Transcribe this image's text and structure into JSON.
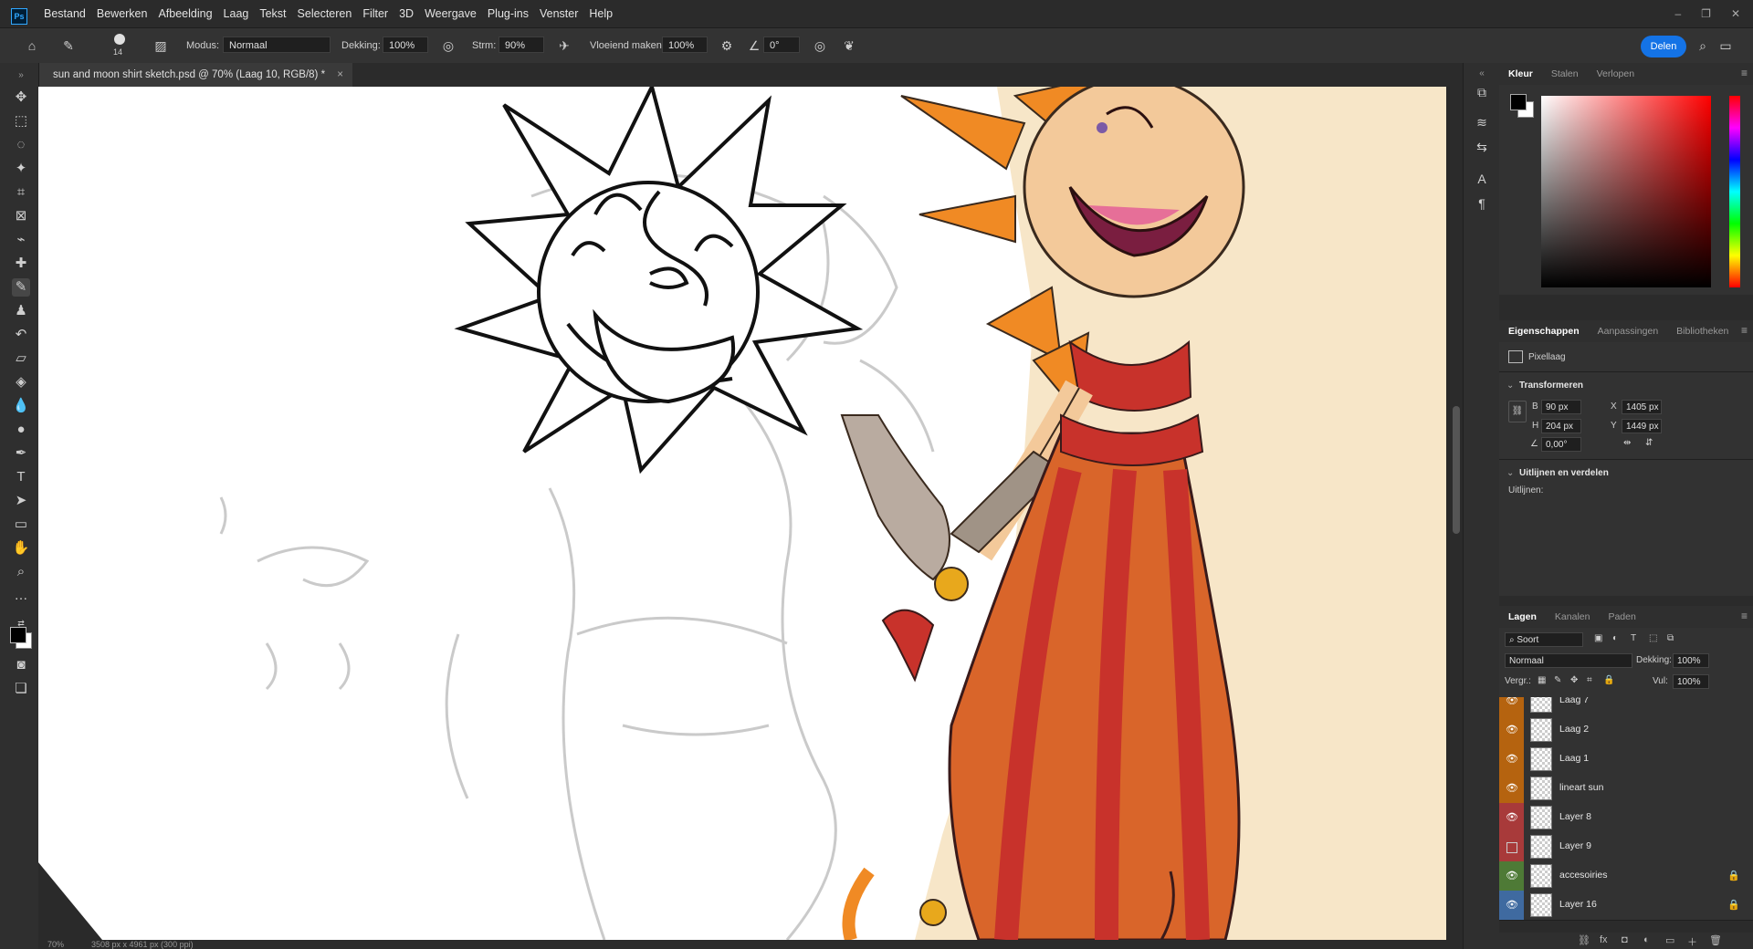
{
  "menubar": {
    "app_icon": "Ps",
    "items": [
      "Bestand",
      "Bewerken",
      "Afbeelding",
      "Laag",
      "Tekst",
      "Selecteren",
      "Filter",
      "3D",
      "Weergave",
      "Plug-ins",
      "Venster",
      "Help"
    ]
  },
  "options": {
    "brush_size": "14",
    "mode_label": "Modus:",
    "mode_value": "Normaal",
    "opacity_label": "Dekking:",
    "opacity_value": "100%",
    "flow_label": "Strm:",
    "flow_value": "90%",
    "smoothing_label": "Vloeiend maken:",
    "smoothing_value": "100%",
    "angle_value": "0°",
    "share_label": "Delen"
  },
  "document": {
    "tab_title": "sun and moon shirt sketch.psd @ 70% (Laag 10, RGB/8) *",
    "close_glyph": "×",
    "zoom": "70%",
    "size_info": "3508 px x 4961 px (300 ppi)"
  },
  "color_panel": {
    "tabs": [
      "Kleur",
      "Stalen",
      "Verlopen"
    ],
    "active_tab": "Kleur",
    "foreground": "#000000",
    "background": "#ffffff",
    "hue": "#ff0000"
  },
  "properties_panel": {
    "tabs": [
      "Eigenschappen",
      "Aanpassingen",
      "Bibliotheken"
    ],
    "active_tab": "Eigenschappen",
    "layer_type": "Pixellaag",
    "transform_title": "Transformeren",
    "w_label": "B",
    "w_value": "90 px",
    "h_label": "H",
    "h_value": "204 px",
    "x_label": "X",
    "x_value": "1405 px",
    "y_label": "Y",
    "y_value": "1449 px",
    "angle_value": "0,00°",
    "align_title": "Uitlijnen en verdelen",
    "align_label": "Uitlijnen:"
  },
  "layers_panel": {
    "tabs": [
      "Lagen",
      "Kanalen",
      "Paden"
    ],
    "active_tab": "Lagen",
    "filter_label": "Soort",
    "blend_mode": "Normaal",
    "opacity_label": "Dekking:",
    "opacity_value": "100%",
    "lock_label": "Vergr.:",
    "fill_label": "Vul:",
    "fill_value": "100%",
    "layers": [
      {
        "name": "Laag 7",
        "color": "#b5630f",
        "visible": true,
        "locked": false
      },
      {
        "name": "Laag 2",
        "color": "#b5630f",
        "visible": true,
        "locked": false
      },
      {
        "name": "Laag 1",
        "color": "#b5630f",
        "visible": true,
        "locked": false
      },
      {
        "name": "lineart sun",
        "color": "#b5630f",
        "visible": true,
        "locked": false
      },
      {
        "name": "Layer 8",
        "color": "#a83a3a",
        "visible": true,
        "locked": false
      },
      {
        "name": "Layer 9",
        "color": "#a83a3a",
        "visible": false,
        "locked": false
      },
      {
        "name": "accesoiries",
        "color": "#4e7a36",
        "visible": true,
        "locked": true
      },
      {
        "name": "Layer 16",
        "color": "#3f6aa0",
        "visible": true,
        "locked": true
      }
    ]
  },
  "colors": {
    "accent": "#1473e6",
    "sun_orange": "#f08a24",
    "pants_red": "#c8322b"
  }
}
